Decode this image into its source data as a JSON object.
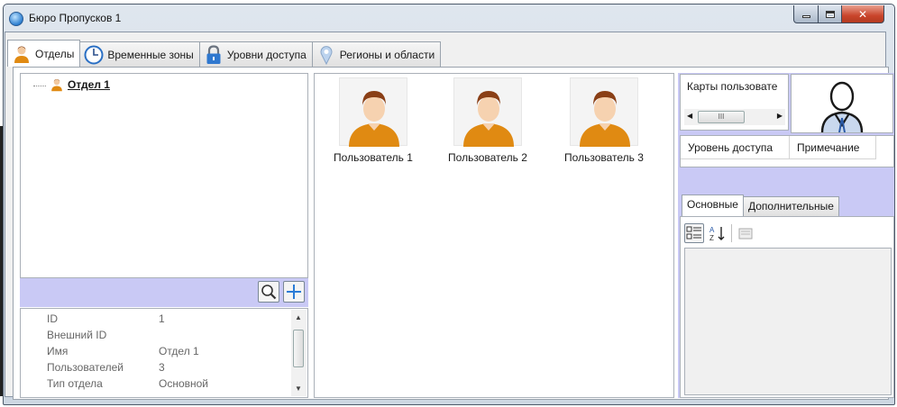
{
  "window": {
    "title": "Бюро Пропусков 1"
  },
  "tabs": [
    {
      "label": "Отделы",
      "icon": "person-icon",
      "active": true
    },
    {
      "label": "Временные зоны",
      "icon": "clock-icon",
      "active": false
    },
    {
      "label": "Уровни доступа",
      "icon": "lock-icon",
      "active": false
    },
    {
      "label": "Регионы и области",
      "icon": "region-icon",
      "active": false
    }
  ],
  "tree": {
    "node_label": "Отдел 1"
  },
  "properties": [
    {
      "name": "ID",
      "value": "1"
    },
    {
      "name": "Внешний ID",
      "value": ""
    },
    {
      "name": "Имя",
      "value": "Отдел 1"
    },
    {
      "name": "Пользователей",
      "value": "3"
    },
    {
      "name": "Тип отдела",
      "value": "Основной"
    }
  ],
  "users": [
    {
      "label": "Пользователь 1"
    },
    {
      "label": "Пользователь 2"
    },
    {
      "label": "Пользователь 3"
    }
  ],
  "right": {
    "cards_label": "Карты пользовате",
    "scroll_thumb": "III",
    "columns": [
      "Уровень доступа",
      "Примечание"
    ],
    "subtabs": [
      "Основные",
      "Дополнительные"
    ]
  },
  "colors": {
    "accent_panel": "#c9c9f5",
    "user_shirt": "#e08a12"
  }
}
